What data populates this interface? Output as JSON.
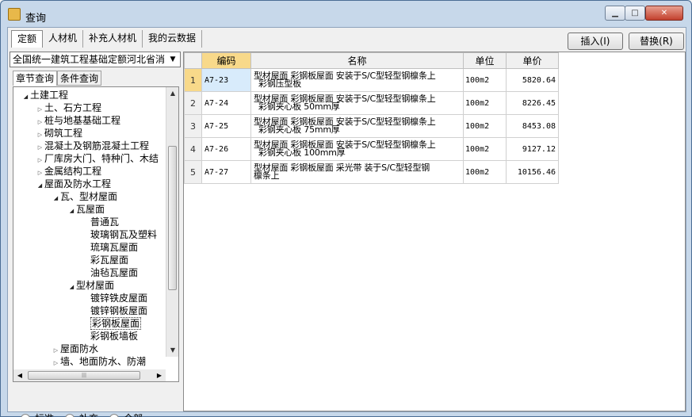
{
  "window": {
    "title": "查询"
  },
  "top_tabs": [
    "定额",
    "人材机",
    "补充人材机",
    "我的云数据"
  ],
  "buttons": {
    "insert": "插入(I)",
    "replace": "替换(R)"
  },
  "library": {
    "selected": "全国统一建筑工程基础定额河北省消"
  },
  "sub_tabs": [
    "章节查询",
    "条件查询"
  ],
  "tree": [
    {
      "label": "土建工程",
      "level": 0,
      "state": "open"
    },
    {
      "label": "土、石方工程",
      "level": 1,
      "state": "closed"
    },
    {
      "label": "桩与地基基础工程",
      "level": 1,
      "state": "closed"
    },
    {
      "label": "砌筑工程",
      "level": 1,
      "state": "closed"
    },
    {
      "label": "混凝土及钢筋混凝土工程",
      "level": 1,
      "state": "closed"
    },
    {
      "label": "厂库房大门、特种门、木结",
      "level": 1,
      "state": "closed"
    },
    {
      "label": "金属结构工程",
      "level": 1,
      "state": "closed"
    },
    {
      "label": "屋面及防水工程",
      "level": 1,
      "state": "open"
    },
    {
      "label": "瓦、型材屋面",
      "level": 2,
      "state": "open"
    },
    {
      "label": "瓦屋面",
      "level": 3,
      "state": "open"
    },
    {
      "label": "普通瓦",
      "level": 4,
      "state": "leaf"
    },
    {
      "label": "玻璃钢瓦及塑料",
      "level": 4,
      "state": "leaf"
    },
    {
      "label": "琉璃瓦屋面",
      "level": 4,
      "state": "leaf"
    },
    {
      "label": "彩瓦屋面",
      "level": 4,
      "state": "leaf"
    },
    {
      "label": "油毡瓦屋面",
      "level": 4,
      "state": "leaf"
    },
    {
      "label": "型材屋面",
      "level": 3,
      "state": "open"
    },
    {
      "label": "镀锌铁皮屋面",
      "level": 4,
      "state": "leaf"
    },
    {
      "label": "镀锌钢板屋面",
      "level": 4,
      "state": "leaf"
    },
    {
      "label": "彩钢板屋面",
      "level": 4,
      "state": "leaf",
      "selected": true
    },
    {
      "label": "彩钢板墙板",
      "level": 4,
      "state": "leaf"
    },
    {
      "label": "屋面防水",
      "level": 2,
      "state": "closed"
    },
    {
      "label": "墙、地面防水、防潮",
      "level": 2,
      "state": "closed"
    }
  ],
  "filter": {
    "options": [
      "标准",
      "补充",
      "全部"
    ],
    "selected": "全部"
  },
  "table": {
    "headers": [
      "编码",
      "名称",
      "单位",
      "单价"
    ],
    "rows": [
      {
        "n": "1",
        "code": "A7-23",
        "name1": "型材屋面 彩钢板屋面 安装于S/C型轻型钢檩条上",
        "name2": "彩钢压型板",
        "unit": "100m2",
        "price": "5820.64"
      },
      {
        "n": "2",
        "code": "A7-24",
        "name1": "型材屋面 彩钢板屋面 安装于S/C型轻型钢檩条上",
        "name2": "彩钢夹心板 50mm厚",
        "unit": "100m2",
        "price": "8226.45"
      },
      {
        "n": "3",
        "code": "A7-25",
        "name1": "型材屋面 彩钢板屋面 安装于S/C型轻型钢檩条上",
        "name2": "彩钢夹心板 75mm厚",
        "unit": "100m2",
        "price": "8453.08"
      },
      {
        "n": "4",
        "code": "A7-26",
        "name1": "型材屋面 彩钢板屋面 安装于S/C型轻型钢檩条上",
        "name2": "彩钢夹心板 100mm厚",
        "unit": "100m2",
        "price": "9127.12"
      },
      {
        "n": "5",
        "code": "A7-27",
        "name1": "型材屋面 彩钢板屋面 采光带 装于S/C型轻型钢",
        "name2": "檩条上",
        "unit": "100m2",
        "price": "10156.46"
      }
    ]
  },
  "icons": {
    "window": "query-window-icon",
    "dropdown": "chevron-down-icon",
    "tree_open": "triangle-down-icon",
    "tree_closed": "triangle-right-icon"
  },
  "colors": {
    "selected_header": "#f8d98a",
    "selected_cell": "#d8ebfb",
    "window_frame": "#c7d8ea",
    "close_button": "#c3402d"
  }
}
